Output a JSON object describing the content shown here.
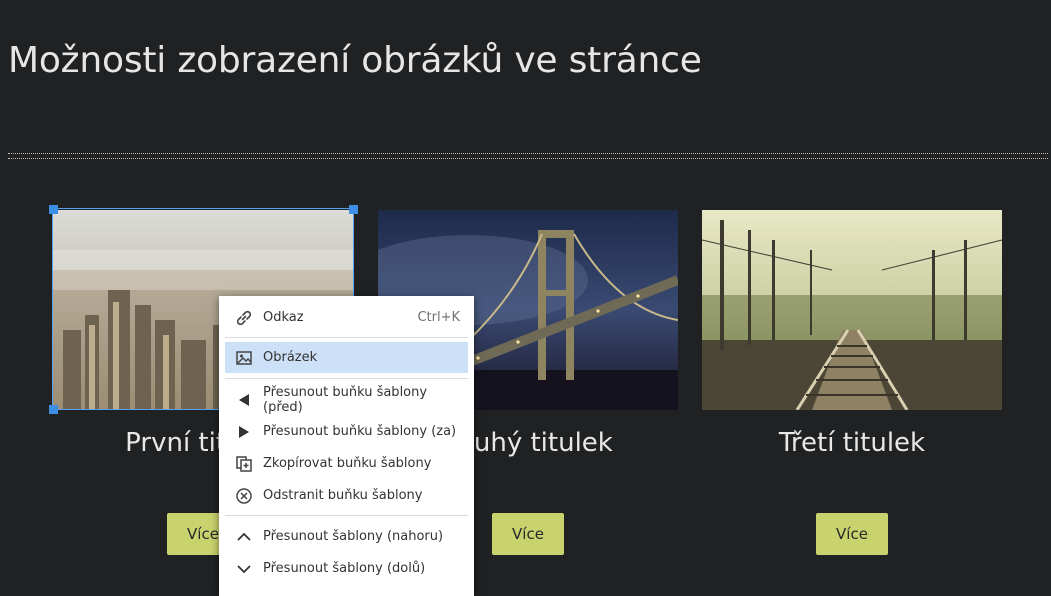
{
  "page": {
    "title": "Možnosti zobrazení obrázků ve stránce"
  },
  "cards": [
    {
      "title": "První titulek",
      "image_icon": "city-photo",
      "button": "Více"
    },
    {
      "title": "Druhý titulek",
      "image_icon": "bridge-photo",
      "button": "Více"
    },
    {
      "title": "Třetí titulek",
      "image_icon": "railway-photo",
      "button": "Více"
    }
  ],
  "context_menu": {
    "items": [
      {
        "label": "Odkaz",
        "shortcut": "Ctrl+K",
        "icon": "link-icon"
      },
      {
        "label": "Obrázek",
        "shortcut": "",
        "icon": "image-icon",
        "active": true
      },
      {
        "label": "Přesunout buňku šablony (před)",
        "shortcut": "",
        "icon": "triangle-left-icon"
      },
      {
        "label": "Přesunout buňku šablony (za)",
        "shortcut": "",
        "icon": "triangle-right-icon"
      },
      {
        "label": "Zkopírovat buňku šablony",
        "shortcut": "",
        "icon": "copy-add-icon"
      },
      {
        "label": "Odstranit buňku šablony",
        "shortcut": "",
        "icon": "circle-x-icon"
      },
      {
        "label": "Přesunout šablony (nahoru)",
        "shortcut": "",
        "icon": "chevron-up-icon"
      },
      {
        "label": "Přesunout šablony (dolů)",
        "shortcut": "",
        "icon": "chevron-down-icon"
      }
    ]
  },
  "colors": {
    "background": "#1f2123",
    "button": "#c9d36d",
    "selection": "#3d8ee6",
    "menu_active": "#cce0f7"
  }
}
